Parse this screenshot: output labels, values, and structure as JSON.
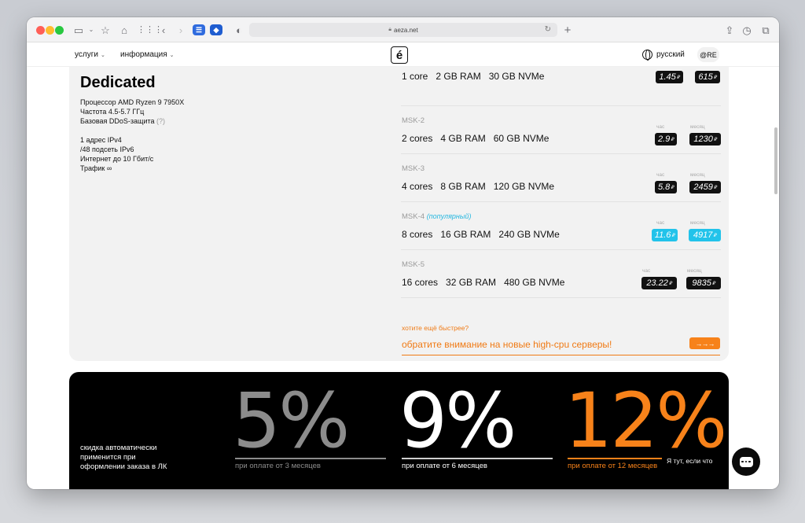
{
  "browser": {
    "url": "aeza.net",
    "colors": {
      "red": "#ff5f57",
      "yellow": "#febc2e",
      "green": "#28c840"
    }
  },
  "nav": {
    "services": "услуги",
    "info": "информация",
    "logo": "é",
    "language": "русский",
    "account": "@RE"
  },
  "dedicated": {
    "title": "Dedicated",
    "cpu": "Процессор AMD Ryzen 9 7950X",
    "freq": "Частота 4.5-5.7 ГГц",
    "ddos": "Базовая DDoS-защита",
    "ddos_hint": "(?)",
    "ipv4": "1 адрес IPv4",
    "ipv6": "/48 подсеть IPv6",
    "internet": "Интернет до 10 Гбит/с",
    "traffic": "Трафик ∞"
  },
  "plans": [
    {
      "name": "",
      "popular": "",
      "cores": "1 core",
      "ram": "2 GB RAM",
      "disk": "30 GB NVMe",
      "hour_label": "",
      "month_label": "",
      "hour": "1.45",
      "month": "615",
      "highlight": false
    },
    {
      "name": "MSK-2",
      "popular": "",
      "cores": "2 cores",
      "ram": "4 GB RAM",
      "disk": "60 GB NVMe",
      "hour_label": "час",
      "month_label": "месяц",
      "hour": "2.9",
      "month": "1230",
      "highlight": false
    },
    {
      "name": "MSK-3",
      "popular": "",
      "cores": "4 cores",
      "ram": "8 GB RAM",
      "disk": "120 GB NVMe",
      "hour_label": "час",
      "month_label": "месяц",
      "hour": "5.8",
      "month": "2459",
      "highlight": false
    },
    {
      "name": "MSK-4",
      "popular": "(популярный)",
      "cores": "8 cores",
      "ram": "16 GB RAM",
      "disk": "240 GB NVMe",
      "hour_label": "час",
      "month_label": "месяц",
      "hour": "11.6",
      "month": "4917",
      "highlight": true
    },
    {
      "name": "MSK-5",
      "popular": "",
      "cores": "16 cores",
      "ram": "32 GB RAM",
      "disk": "480 GB NVMe",
      "hour_label": "час",
      "month_label": "месяц",
      "hour": "23.22",
      "month": "9835",
      "highlight": false
    }
  ],
  "currency": "₽",
  "faster": {
    "question": "хотите ещё быстрее?",
    "link": "обратите внимание на новые high-cpu серверы!",
    "arrows": "→→→"
  },
  "discounts": {
    "note_line1": "скидка автоматически",
    "note_line2": "применится при",
    "note_line3": "оформлении заказа в ЛК",
    "items": [
      {
        "value": "5%",
        "caption": "при оплате от 3 месяцев",
        "color": "#8c8c8c"
      },
      {
        "value": "9%",
        "caption": "при оплате от 6 месяцев",
        "color": "#ffffff"
      },
      {
        "value": "12%",
        "caption": "при оплате от 12 месяцев",
        "color": "#f7821a"
      }
    ]
  },
  "chat": {
    "tooltip": "Я тут, если что"
  }
}
